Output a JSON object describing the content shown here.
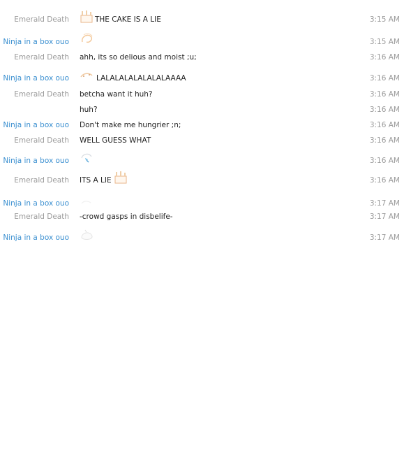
{
  "messages": [
    {
      "sender": "Emerald Death",
      "text": "THE CAKE IS A LIE",
      "time": "3:15 AM",
      "emote": "cake-emote"
    },
    {
      "sender": "Ninja in a box ouo",
      "text": "",
      "time": "3:15 AM",
      "emote": "swirl-emote"
    },
    {
      "sender": "Emerald Death",
      "text": "ahh, its so delious and moist ;u;",
      "time": "3:16 AM",
      "emote": ""
    },
    {
      "sender": "Ninja in a box ouo",
      "text": "LALALALALALALALAAAA",
      "time": "3:16 AM",
      "emote": "singing-emote"
    },
    {
      "sender": "Emerald Death",
      "text": "betcha want it huh?",
      "time": "3:16 AM",
      "emote": ""
    },
    {
      "sender": "",
      "text": "huh?",
      "time": "3:16 AM",
      "emote": ""
    },
    {
      "sender": "Ninja in a box ouo",
      "text": "Don't make me hungrier ;n;",
      "time": "3:16 AM",
      "emote": ""
    },
    {
      "sender": "Emerald Death",
      "text": "WELL GUESS WHAT",
      "time": "3:16 AM",
      "emote": ""
    },
    {
      "sender": "Ninja in a box ouo",
      "text": "",
      "time": "3:16 AM",
      "emote": "crying-emote"
    },
    {
      "sender": "Emerald Death",
      "text": "ITS A LIE",
      "time": "3:16 AM",
      "emote": "cake-emote"
    },
    {
      "sender": "Ninja in a box ouo",
      "text": "",
      "time": "3:17 AM",
      "emote": "faint-emote"
    },
    {
      "sender": "Emerald Death",
      "text": "-crowd gasps in disbelife-",
      "time": "3:17 AM",
      "emote": ""
    },
    {
      "sender": "Ninja in a box ouo",
      "text": "",
      "time": "3:17 AM",
      "emote": "blob-emote"
    }
  ],
  "colors": {
    "sender_emerald": "#9a9a9a",
    "sender_ninja": "#3a8fd0",
    "message_text": "#222222",
    "timestamp": "#9a9a9a"
  }
}
